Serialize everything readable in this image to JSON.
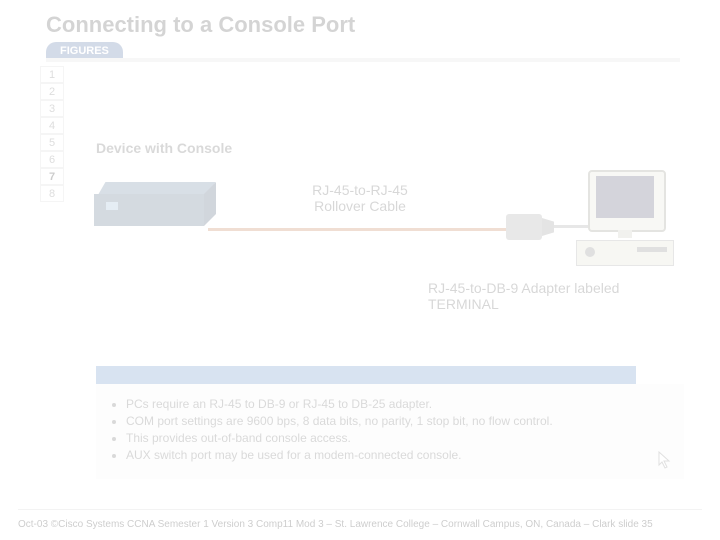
{
  "header": {
    "title": "Connecting to a Console Port",
    "figures_tab": "FIGURES"
  },
  "figures": {
    "items": [
      "1",
      "2",
      "3",
      "4",
      "5",
      "6",
      "7",
      "8"
    ],
    "active_index": 6
  },
  "labels": {
    "device_with_console": "Device with Console",
    "pc": "PC",
    "rollover_cable": "RJ-45-to-RJ-45 Rollover Cable",
    "adapter": "RJ-45-to-DB-9 Adapter labeled TERMINAL"
  },
  "notes": {
    "bullets": [
      "PCs require an RJ-45 to DB-9 or RJ-45 to DB-25 adapter.",
      "COM port settings are 9600 bps, 8 data bits, no parity, 1 stop bit, no flow control.",
      "This provides out-of-band console access.",
      "AUX switch port may be used for a modem-connected console."
    ]
  },
  "footer": {
    "text": "Oct-03 ©Cisco Systems CCNA Semester 1 Version 3 Comp11 Mod 3 – St. Lawrence College – Cornwall Campus, ON, Canada – Clark  slide  35"
  },
  "icons": {
    "router": "router-icon",
    "db9": "db9-adapter-icon",
    "pc": "pc-icon",
    "cursor": "cursor-icon"
  }
}
